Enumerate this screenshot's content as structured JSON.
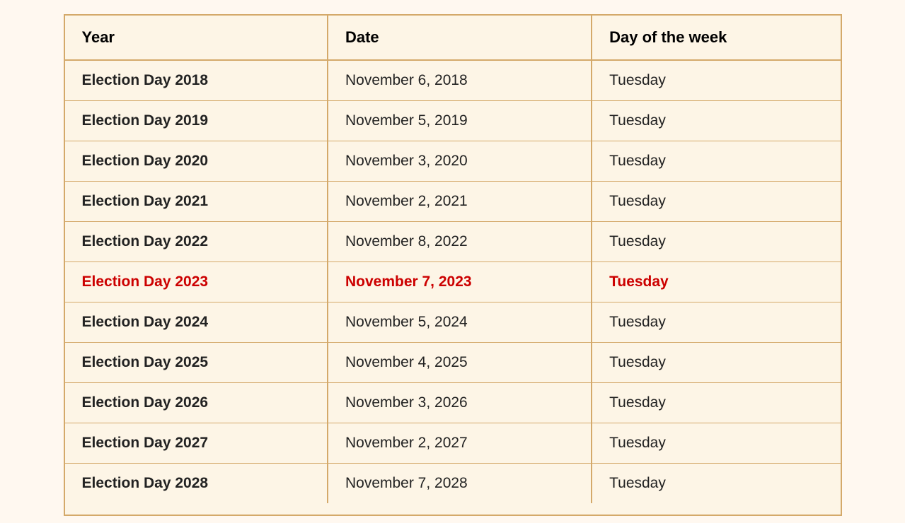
{
  "table": {
    "headers": [
      "Year",
      "Date",
      "Day of the week"
    ],
    "rows": [
      {
        "year": "Election Day 2018",
        "date": "November 6, 2018",
        "day": "Tuesday",
        "highlight": false
      },
      {
        "year": "Election Day 2019",
        "date": "November 5, 2019",
        "day": "Tuesday",
        "highlight": false
      },
      {
        "year": "Election Day 2020",
        "date": "November 3, 2020",
        "day": "Tuesday",
        "highlight": false
      },
      {
        "year": "Election Day 2021",
        "date": "November 2, 2021",
        "day": "Tuesday",
        "highlight": false
      },
      {
        "year": "Election Day 2022",
        "date": "November 8, 2022",
        "day": "Tuesday",
        "highlight": false
      },
      {
        "year": "Election Day 2023",
        "date": "November 7, 2023",
        "day": "Tuesday",
        "highlight": true
      },
      {
        "year": "Election Day 2024",
        "date": "November 5, 2024",
        "day": "Tuesday",
        "highlight": false
      },
      {
        "year": "Election Day 2025",
        "date": "November 4, 2025",
        "day": "Tuesday",
        "highlight": false
      },
      {
        "year": "Election Day 2026",
        "date": "November 3, 2026",
        "day": "Tuesday",
        "highlight": false
      },
      {
        "year": "Election Day 2027",
        "date": "November 2, 2027",
        "day": "Tuesday",
        "highlight": false
      },
      {
        "year": "Election Day 2028",
        "date": "November 7, 2028",
        "day": "Tuesday",
        "highlight": false
      }
    ]
  }
}
